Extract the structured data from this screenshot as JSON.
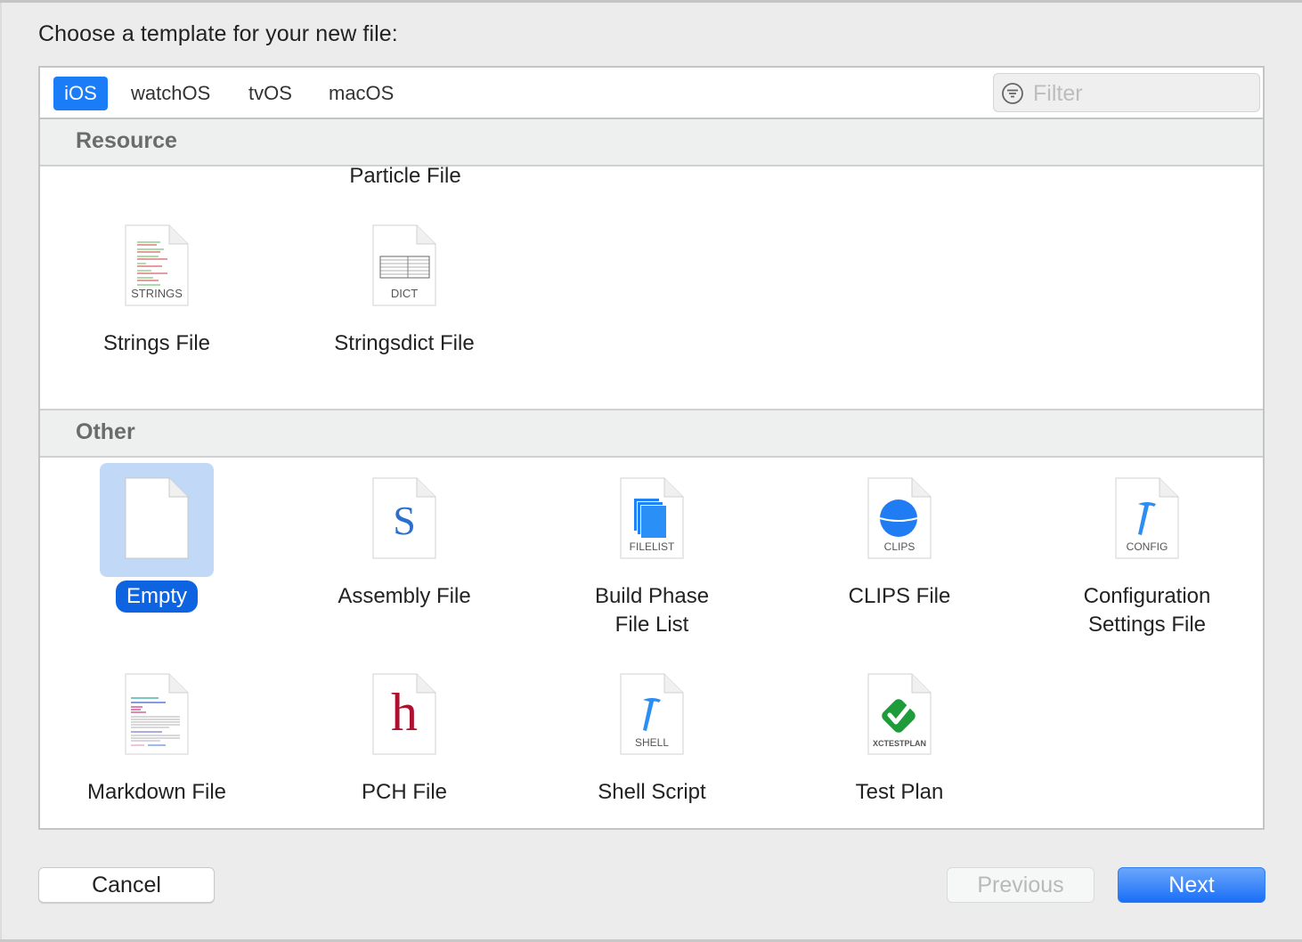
{
  "dialog": {
    "prompt": "Choose a template for your new file:"
  },
  "platform_tabs": [
    {
      "label": "iOS",
      "active": true
    },
    {
      "label": "watchOS",
      "active": false
    },
    {
      "label": "tvOS",
      "active": false
    },
    {
      "label": "macOS",
      "active": false
    }
  ],
  "filter": {
    "placeholder": "Filter",
    "value": "",
    "icon": "filter-icon"
  },
  "sections": {
    "resource": {
      "title": "Resource",
      "partial_item_label": "Particle File",
      "items": [
        {
          "label": "Strings File",
          "badge": "STRINGS",
          "icon": "strings-file-icon"
        },
        {
          "label": "Stringsdict File",
          "badge": "DICT",
          "icon": "stringsdict-file-icon"
        }
      ]
    },
    "other": {
      "title": "Other",
      "items": [
        {
          "label": "Empty",
          "badge": "",
          "icon": "empty-file-icon",
          "selected": true
        },
        {
          "label": "Assembly File",
          "badge": "",
          "glyph": "S",
          "icon": "assembly-file-icon"
        },
        {
          "label": "Build Phase\nFile List",
          "label_line1": "Build Phase",
          "label_line2": "File List",
          "badge": "FILELIST",
          "icon": "filelist-icon"
        },
        {
          "label": "CLIPS File",
          "badge": "CLIPS",
          "icon": "clips-file-icon"
        },
        {
          "label": "Configuration\nSettings File",
          "label_line1": "Configuration",
          "label_line2": "Settings File",
          "badge": "CONFIG",
          "icon": "config-file-icon"
        },
        {
          "label": "Markdown File",
          "badge": "",
          "icon": "markdown-file-icon"
        },
        {
          "label": "PCH File",
          "badge": "",
          "glyph": "h",
          "icon": "pch-file-icon"
        },
        {
          "label": "Shell Script",
          "badge": "SHELL",
          "icon": "shell-script-icon"
        },
        {
          "label": "Test Plan",
          "badge": "XCTESTPLAN",
          "icon": "test-plan-icon"
        }
      ]
    }
  },
  "buttons": {
    "cancel": "Cancel",
    "previous": "Previous",
    "next": "Next",
    "previous_enabled": false
  },
  "colors": {
    "accent": "#1a7df7",
    "selection_bg": "#c1d9f7",
    "selected_label_bg": "#0e64e0",
    "assembly_glyph": "#2a6fd0",
    "pch_glyph": "#b0102f",
    "hammer_blue": "#2b8ef5",
    "testplan_green": "#1f9c3a"
  }
}
